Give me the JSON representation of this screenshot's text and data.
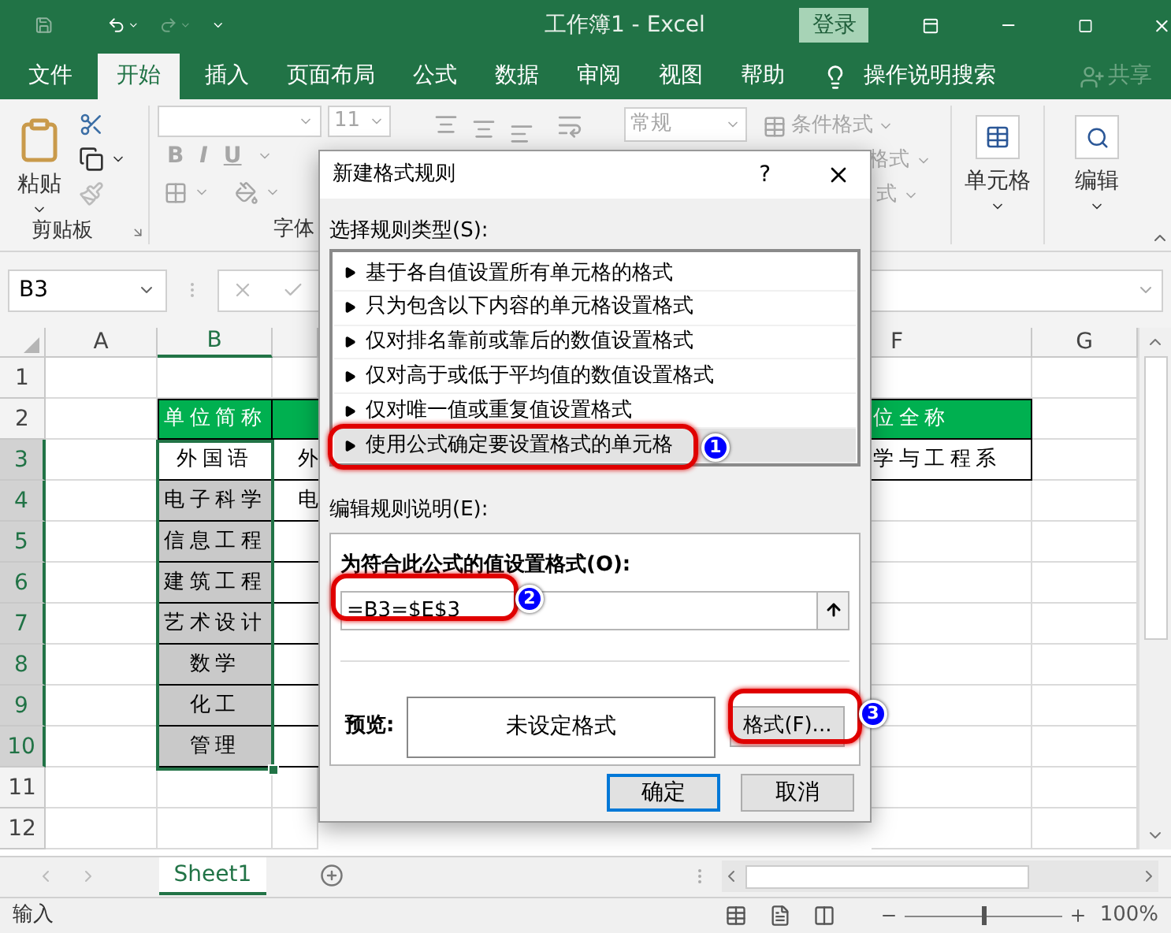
{
  "title_bar": {
    "title": "工作簿1 - Excel",
    "sign_in": "登录"
  },
  "ribbon_tabs": [
    {
      "label": "文件",
      "selected": false
    },
    {
      "label": "开始",
      "selected": true
    },
    {
      "label": "插入",
      "selected": false
    },
    {
      "label": "页面布局",
      "selected": false
    },
    {
      "label": "公式",
      "selected": false
    },
    {
      "label": "数据",
      "selected": false
    },
    {
      "label": "审阅",
      "selected": false
    },
    {
      "label": "视图",
      "selected": false
    },
    {
      "label": "帮助",
      "selected": false
    }
  ],
  "tell_me": "操作说明搜索",
  "share": {
    "label": "共享",
    "disabled": true
  },
  "ribbon": {
    "paste": "粘贴",
    "clipboard_label": "剪贴板",
    "font_size": "11",
    "font_styles": [
      "B",
      "I",
      "U"
    ],
    "font_label": "字体",
    "number_format": "常规",
    "conditional_formatting": "条件格式",
    "table_format": "格式",
    "cell_styles": "式",
    "cells": "单元格",
    "editing": "编辑"
  },
  "name_box": "B3",
  "columns_left": [
    {
      "label": "A",
      "selected": false
    },
    {
      "label": "B",
      "selected": true
    }
  ],
  "columns_right": [
    {
      "label": "F",
      "selected": false
    },
    {
      "label": "G",
      "selected": false
    }
  ],
  "row_headers": [
    {
      "label": "1",
      "selected": false
    },
    {
      "label": "2",
      "selected": false
    },
    {
      "label": "3",
      "selected": true
    },
    {
      "label": "4",
      "selected": true
    },
    {
      "label": "5",
      "selected": true
    },
    {
      "label": "6",
      "selected": true
    },
    {
      "label": "7",
      "selected": true
    },
    {
      "label": "8",
      "selected": true
    },
    {
      "label": "9",
      "selected": true
    },
    {
      "label": "10",
      "selected": true
    },
    {
      "label": "11",
      "selected": false
    },
    {
      "label": "12",
      "selected": false
    }
  ],
  "table": {
    "header_left": "单位简称",
    "header_right": "位全称",
    "rows": [
      {
        "name": "外国语",
        "active": true,
        "column_c": "外",
        "right": "学与工程系"
      },
      {
        "name": "电子科学",
        "active": false,
        "column_c": "电"
      },
      {
        "name": "信息工程",
        "active": false
      },
      {
        "name": "建筑工程",
        "active": false
      },
      {
        "name": "艺术设计",
        "active": false
      },
      {
        "name": "数学",
        "active": false
      },
      {
        "name": "化工",
        "active": false
      },
      {
        "name": "管理",
        "active": false
      }
    ]
  },
  "sheet_tabs": [
    {
      "label": "Sheet1",
      "selected": true
    }
  ],
  "status": "输入",
  "zoom_slider": {
    "level": 0.5
  },
  "zoom": "100%",
  "dialog": {
    "title": "新建格式规则",
    "help": "?",
    "rule_type_label": "选择规则类型(S):",
    "rule_types": [
      {
        "label": "基于各自值设置所有单元格的格式",
        "selected": false
      },
      {
        "label": "只为包含以下内容的单元格设置格式",
        "selected": false
      },
      {
        "label": "仅对排名靠前或靠后的数值设置格式",
        "selected": false
      },
      {
        "label": "仅对高于或低于平均值的数值设置格式",
        "selected": false
      },
      {
        "label": "仅对唯一值或重复值设置格式",
        "selected": false
      },
      {
        "label": "使用公式确定要设置格式的单元格",
        "selected": true
      }
    ],
    "description_label": "编辑规则说明(E):",
    "formula_label": "为符合此公式的值设置格式(O):",
    "formula": "=B3=$E$3",
    "preview_label": "预览:",
    "preview": "未设定格式",
    "format_button": "格式(F)...",
    "ok": "确定",
    "cancel": "取消"
  },
  "annotations": [
    {
      "number": "1"
    },
    {
      "number": "2"
    },
    {
      "number": "3"
    }
  ]
}
